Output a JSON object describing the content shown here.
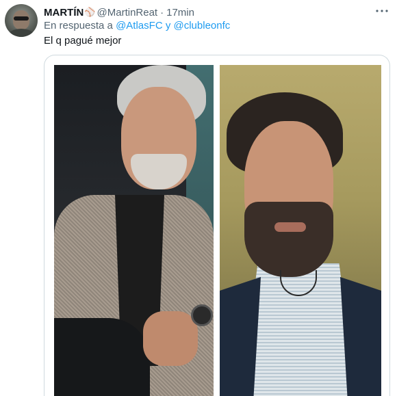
{
  "tweet": {
    "display_name": "MARTÍN",
    "name_emoji": "⚾",
    "handle": "@MartinReat",
    "separator": "·",
    "time": "17min",
    "more_icon": "more-icon",
    "reply_prefix": "En respuesta a",
    "reply_user_1": "@AtlasFC",
    "reply_joiner": "y",
    "reply_user_2": "@clubleonfc",
    "text": "El q pagué mejor"
  },
  "colors": {
    "link": "#1d9bf0",
    "secondary_text": "#536471",
    "primary_text": "#0f1419",
    "border": "#cfd9de"
  }
}
